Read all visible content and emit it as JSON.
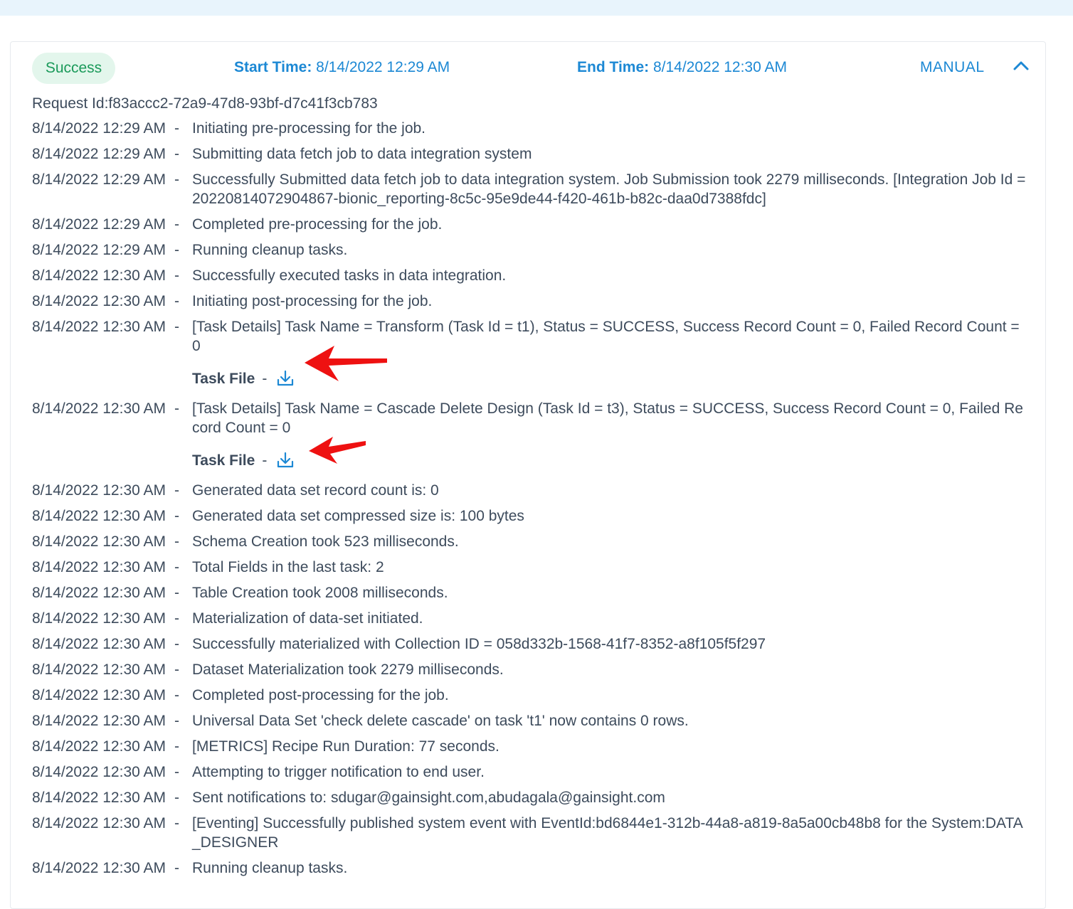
{
  "status": "Success",
  "start_time": {
    "label": "Start Time:",
    "value": "8/14/2022 12:29 AM"
  },
  "end_time": {
    "label": "End Time:",
    "value": "8/14/2022 12:30 AM"
  },
  "mode": "MANUAL",
  "request_id": "Request Id:f83accc2-72a9-47d8-93bf-d7c41f3cb783",
  "task_file_label": "Task File",
  "separator": "-",
  "logs": [
    {
      "time": "8/14/2022 12:29 AM",
      "msg": "Initiating pre-processing for the job."
    },
    {
      "time": "8/14/2022 12:29 AM",
      "msg": "Submitting data fetch job to data integration system"
    },
    {
      "time": "8/14/2022 12:29 AM",
      "msg": "Successfully Submitted data fetch job to data integration system. Job Submission took 2279 milliseconds. [Integration Job Id = 20220814072904867-bionic_reporting-8c5c-95e9de44-f420-461b-b82c-daa0d7388fdc]"
    },
    {
      "time": "8/14/2022 12:29 AM",
      "msg": "Completed pre-processing for the job."
    },
    {
      "time": "8/14/2022 12:29 AM",
      "msg": "Running cleanup tasks."
    },
    {
      "time": "8/14/2022 12:30 AM",
      "msg": "Successfully executed tasks in data integration."
    },
    {
      "time": "8/14/2022 12:30 AM",
      "msg": "Initiating post-processing for the job."
    },
    {
      "time": "8/14/2022 12:30 AM",
      "msg": "[Task Details] Task Name = Transform (Task Id = t1), Status = SUCCESS, Success Record Count = 0, Failed Record Count = 0"
    },
    {
      "time": "8/14/2022 12:30 AM",
      "msg": "[Task Details] Task Name = Cascade Delete Design (Task Id = t3), Status = SUCCESS, Success Record Count = 0, Failed Record Count = 0"
    },
    {
      "time": "8/14/2022 12:30 AM",
      "msg": "Generated data set record count is: 0"
    },
    {
      "time": "8/14/2022 12:30 AM",
      "msg": "Generated data set compressed size is: 100 bytes"
    },
    {
      "time": "8/14/2022 12:30 AM",
      "msg": "Schema Creation took 523 milliseconds."
    },
    {
      "time": "8/14/2022 12:30 AM",
      "msg": "Total Fields in the last task: 2"
    },
    {
      "time": "8/14/2022 12:30 AM",
      "msg": "Table Creation took 2008 milliseconds."
    },
    {
      "time": "8/14/2022 12:30 AM",
      "msg": "Materialization of data-set initiated."
    },
    {
      "time": "8/14/2022 12:30 AM",
      "msg": "Successfully materialized with Collection ID = 058d332b-1568-41f7-8352-a8f105f5f297"
    },
    {
      "time": "8/14/2022 12:30 AM",
      "msg": "Dataset Materialization took 2279 milliseconds."
    },
    {
      "time": "8/14/2022 12:30 AM",
      "msg": "Completed post-processing for the job."
    },
    {
      "time": "8/14/2022 12:30 AM",
      "msg": "Universal Data Set 'check delete cascade' on task 't1' now contains 0 rows."
    },
    {
      "time": "8/14/2022 12:30 AM",
      "msg": "[METRICS] Recipe Run Duration: 77 seconds."
    },
    {
      "time": "8/14/2022 12:30 AM",
      "msg": "Attempting to trigger notification to end user."
    },
    {
      "time": "8/14/2022 12:30 AM",
      "msg": "Sent notifications to: sdugar@gainsight.com,abudagala@gainsight.com"
    },
    {
      "time": "8/14/2022 12:30 AM",
      "msg": "[Eventing] Successfully published system event with EventId:bd6844e1-312b-44a8-a819-8a5a00cb48b8 for the System:DATA_DESIGNER"
    },
    {
      "time": "8/14/2022 12:30 AM",
      "msg": "Running cleanup tasks."
    }
  ],
  "colors": {
    "accent": "#1c88d4",
    "success_bg": "#e3f6ec",
    "success_text": "#1a9a5a",
    "annotation_arrow": "#ee1111"
  },
  "icons": {
    "collapse": "chevron-up-icon",
    "download": "download-icon",
    "annotation": "red-arrow-icon"
  }
}
